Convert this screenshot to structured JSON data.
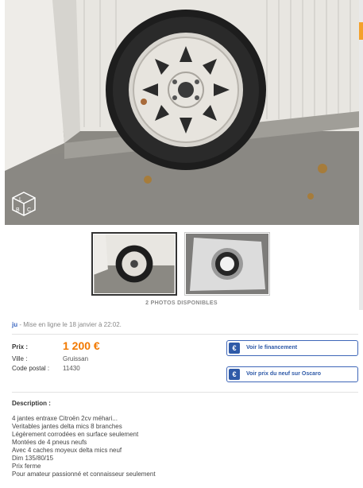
{
  "gallery": {
    "photos_available": "2 PHOTOS DISPONIBLES",
    "logo_letters": [
      "L",
      "B",
      "C"
    ]
  },
  "listing": {
    "author": "ju",
    "posted_text": "- Mise en ligne le 18 janvier à 22:02.",
    "price_label": "Prix :",
    "price": "1 200 €",
    "city_label": "Ville :",
    "city": "Gruissan",
    "zip_label": "Code postal :",
    "zip": "11430"
  },
  "actions": {
    "financing_label": "Voir le financement",
    "financing_icon": "€",
    "new_price_label": "Voir prix du neuf sur Oscaro",
    "new_price_icon": "€"
  },
  "description": {
    "title": "Description :",
    "lines": [
      "4 jantes entraxe Citroën 2cv méhari...",
      "Veritables jantes delta mics 8 branches",
      "Légèrement corrodées en surface seulement",
      "Montées de 4 pneus neufs",
      "Avec 4 caches moyeux delta mics neuf",
      "Dim 135/80/15",
      "Prix ferme",
      "Pour amateur passionné et connaisseur seulement"
    ]
  },
  "colors": {
    "price": "#f27900",
    "link": "#3a66c0",
    "button_border": "#3e66b8"
  }
}
